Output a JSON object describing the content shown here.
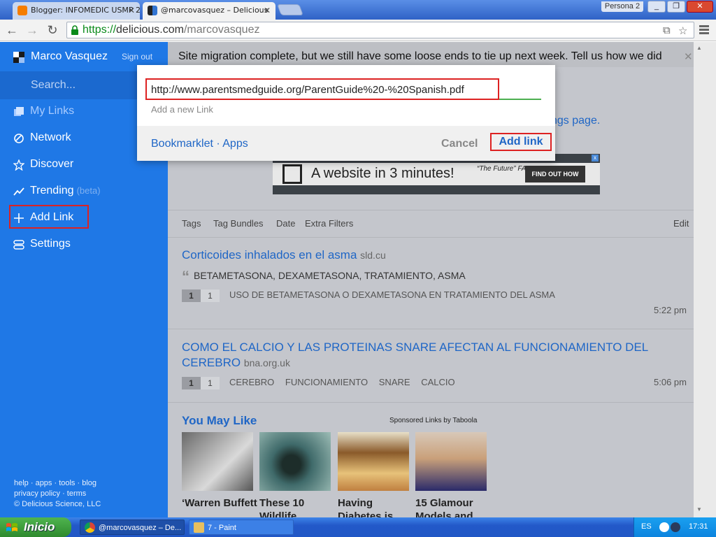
{
  "browser": {
    "tabs": [
      {
        "title": "Blogger: INFOMEDIC USMP 2",
        "favicon": "blogger-icon",
        "color": "#f57d00"
      },
      {
        "title": "@marcovasquez – Delicious",
        "favicon": "delicious-icon",
        "color": "#3274d1"
      }
    ],
    "profile_label": "Persona 2",
    "window_buttons": [
      "_",
      "□",
      "✕"
    ],
    "url": {
      "protocol": "https://",
      "host": "delicious.com",
      "path": "/marcovasquez"
    }
  },
  "sidebar": {
    "user_name": "Marco Vasquez",
    "sign_out": "Sign out",
    "search_placeholder": "Search...",
    "items": [
      {
        "label": "My Links",
        "icon": "links-icon"
      },
      {
        "label": "Network",
        "icon": "network-icon"
      },
      {
        "label": "Discover",
        "icon": "star-icon"
      },
      {
        "label": "Trending",
        "icon": "trending-icon",
        "badge": "(beta)"
      },
      {
        "label": "Add Link",
        "icon": "plus-icon"
      },
      {
        "label": "Settings",
        "icon": "settings-icon"
      }
    ],
    "footer": {
      "line1": "help · apps · tools · blog",
      "line2": "privacy policy · terms",
      "line3": "© Delicious Science, LLC"
    }
  },
  "main": {
    "banner": "Site migration complete, but we still have some loose ends to tie up next week. Tell us how we did",
    "settings_link": "ngs page.",
    "ad": {
      "headline": "A website in 3 minutes!",
      "tagline": "“The Future” FAST COMPANY",
      "cta": "FIND OUT HOW"
    },
    "filters": [
      "Tags",
      "Tag Bundles",
      "Date",
      "Extra Filters"
    ],
    "edit": "Edit",
    "posts": [
      {
        "title": "Corticoides inhalados en el asma",
        "domain": "sld.cu",
        "quote": "BETAMETASONA, DEXAMETASONA, TRATAMIENTO, ASMA",
        "count_a": "1",
        "count_b": "1",
        "tags": [
          "USO DE BETAMETASONA O DEXAMETASONA EN TRATAMIENTO DEL ASMA"
        ],
        "time": "5:22 pm"
      },
      {
        "title": "COMO EL CALCIO Y LAS PROTEINAS SNARE AFECTAN AL FUNCIONAMIENTO DEL CEREBRO",
        "domain": "bna.org.uk",
        "count_a": "1",
        "count_b": "1",
        "tags": [
          "CEREBRO",
          "FUNCIONAMIENTO",
          "SNARE",
          "CALCIO"
        ],
        "time": "5:06 pm"
      }
    ],
    "you_may_like": {
      "title": "You May Like",
      "sponsored": "Sponsored Links by Taboola",
      "items": [
        {
          "caption": "‘Warren Buffett",
          "colors": [
            "#6a6a6a",
            "#d9d9d9"
          ]
        },
        {
          "caption": "These 10 Wildlife",
          "colors": [
            "#3f6a6a",
            "#9dbdb6"
          ]
        },
        {
          "caption": "Having Diabetes is",
          "colors": [
            "#8a5a2a",
            "#e7c27a"
          ]
        },
        {
          "caption": "15 Glamour Models and",
          "colors": [
            "#2a2a6a",
            "#c9a07a"
          ]
        }
      ]
    }
  },
  "modal": {
    "url_value": "http://www.parentsmedguide.org/ParentGuide%20-%20Spanish.pdf",
    "hint": "Add a new Link",
    "links": "Bookmarklet · Apps",
    "cancel": "Cancel",
    "add": "Add link"
  },
  "taskbar": {
    "start": "Inicio",
    "tasks": [
      {
        "label": "@marcovasquez – De...",
        "icon": "chrome-icon"
      },
      {
        "label": "7 - Paint",
        "icon": "paint-icon"
      }
    ],
    "lang": "ES",
    "time": "17:31"
  },
  "colors": {
    "accent": "#1f78e6",
    "link": "#1f66c6",
    "highlight": "#dd2222"
  }
}
